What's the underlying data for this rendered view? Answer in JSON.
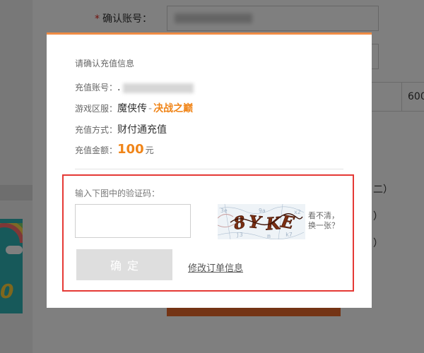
{
  "background": {
    "confirm_account_required": "*",
    "confirm_account_label": "确认账号：",
    "table_value": "600",
    "paren_1": "二）",
    "paren_2": "）",
    "paren_3": "）",
    "promo_number": "0"
  },
  "modal": {
    "title": "请确认充值信息",
    "account": {
      "label": "充值账号：",
      "value_prefix": "."
    },
    "server": {
      "label": "游戏区服：",
      "game": "魔侠传",
      "separator": "-",
      "server_name": "决战之巅"
    },
    "method": {
      "label": "充值方式：",
      "value": "财付通充值"
    },
    "amount": {
      "label": "充值金额：",
      "value": "100",
      "unit": "元"
    },
    "verify": {
      "label": "输入下图中的验证码：",
      "input_value": "",
      "captcha_text": "8YKE",
      "refresh_line1": "看不清，",
      "refresh_line2": "换一张？"
    },
    "confirm_button": "确定",
    "modify_link": "修改订单信息"
  },
  "colors": {
    "accent_orange": "#f08519",
    "modal_top_border": "#f08c44",
    "highlight_border": "#e53935",
    "disabled_button": "#dedede",
    "overlay": "rgba(0,0,0,0.5)"
  }
}
